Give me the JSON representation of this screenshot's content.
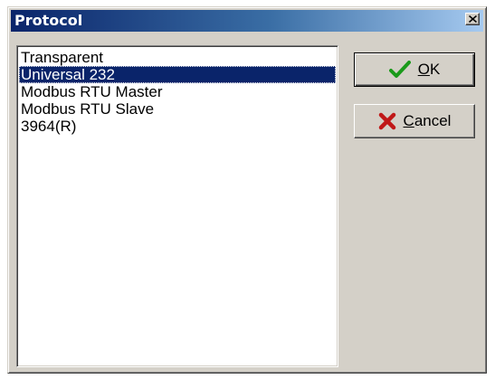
{
  "window": {
    "title": "Protocol"
  },
  "protocol_list": {
    "items": [
      {
        "label": "Transparent",
        "selected": false
      },
      {
        "label": "Universal 232",
        "selected": true
      },
      {
        "label": "Modbus RTU Master",
        "selected": false
      },
      {
        "label": "Modbus RTU Slave",
        "selected": false
      },
      {
        "label": "3964(R)",
        "selected": false
      }
    ]
  },
  "buttons": {
    "ok": {
      "mnemonic": "O",
      "rest": "K",
      "icon": "checkmark-icon",
      "icon_color": "#1a9a1a"
    },
    "cancel": {
      "mnemonic": "C",
      "rest": "ancel",
      "icon": "x-icon",
      "icon_color": "#c01818"
    }
  },
  "colors": {
    "titlebar_start": "#0a246a",
    "titlebar_end": "#a6caf0",
    "selection": "#0a246a",
    "face": "#d4d0c8"
  }
}
